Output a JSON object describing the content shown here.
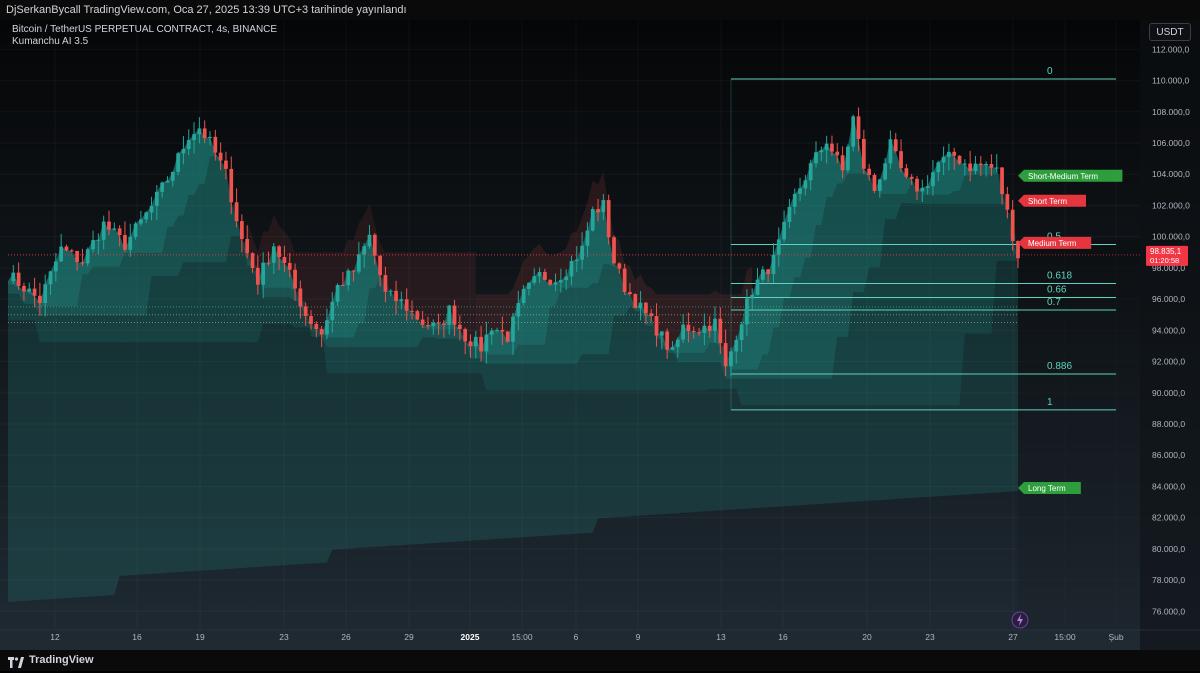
{
  "header": {
    "published_line": "DjSerkanBycall TradingView.com, Oca 27, 2025 13:39 UTC+3 tarihinde yayınlandı"
  },
  "legend": {
    "symbol_line": "Bitcoin / TetherUS PERPETUAL CONTRACT, 4s, BINANCE",
    "indicator_line": "Kumanchu AI 3.5"
  },
  "toolbar": {
    "currency_label": "USDT"
  },
  "footer": {
    "brand": "TradingView"
  },
  "colors": {
    "up": "#26a69a",
    "down": "#ef5350",
    "cloud": "#26a69a",
    "fib_line": "#5fd3bd",
    "label_green": "#2e9e3c",
    "label_red": "#e5363f",
    "price_tag": "#f23645"
  },
  "chart_data": {
    "type": "candlestick",
    "title": "Bitcoin / TetherUS PERPETUAL CONTRACT, 4s, BINANCE",
    "ylim": [
      74800,
      112600
    ],
    "y_ticks": [
      76000,
      78000,
      80000,
      82000,
      84000,
      86000,
      88000,
      90000,
      92000,
      94000,
      96000,
      98000,
      100000,
      102000,
      104000,
      106000,
      108000,
      110000,
      112000
    ],
    "y_tick_labels": [
      "76.000,0",
      "78.000,0",
      "80.000,0",
      "82.000,0",
      "84.000,0",
      "86.000,0",
      "88.000,0",
      "90.000,0",
      "92.000,0",
      "94.000,0",
      "96.000,0",
      "98.000,0",
      "100.000,0",
      "102.000,0",
      "104.000,0",
      "106.000,0",
      "108.000,0",
      "110.000,0",
      "112.000,0"
    ],
    "x_tick_labels": [
      "12",
      "16",
      "19",
      "23",
      "26",
      "29",
      "2025",
      "15:00",
      "6",
      "9",
      "13",
      "16",
      "20",
      "23",
      "27",
      "15:00",
      "Şub"
    ],
    "price_path": [
      [
        0,
        97600
      ],
      [
        6,
        95900
      ],
      [
        10,
        99200
      ],
      [
        14,
        98400
      ],
      [
        18,
        100800
      ],
      [
        22,
        99500
      ],
      [
        27,
        101900
      ],
      [
        31,
        104300
      ],
      [
        34,
        106500
      ],
      [
        36,
        107000
      ],
      [
        38,
        106000
      ],
      [
        41,
        104000
      ],
      [
        44,
        99800
      ],
      [
        47,
        97200
      ],
      [
        50,
        99500
      ],
      [
        53,
        97500
      ],
      [
        56,
        95000
      ],
      [
        59,
        93800
      ],
      [
        62,
        96800
      ],
      [
        65,
        97800
      ],
      [
        68,
        100000
      ],
      [
        71,
        96300
      ],
      [
        74,
        95800
      ],
      [
        78,
        94500
      ],
      [
        81,
        94100
      ],
      [
        83,
        95300
      ],
      [
        86,
        93600
      ],
      [
        89,
        92900
      ],
      [
        91,
        94300
      ],
      [
        94,
        93600
      ],
      [
        97,
        96300
      ],
      [
        100,
        97500
      ],
      [
        103,
        97300
      ],
      [
        105,
        97900
      ],
      [
        108,
        99200
      ],
      [
        110,
        101600
      ],
      [
        112,
        102000
      ],
      [
        114,
        98400
      ],
      [
        116,
        96800
      ],
      [
        119,
        95400
      ],
      [
        122,
        94100
      ],
      [
        125,
        92500
      ],
      [
        127,
        94200
      ],
      [
        130,
        94100
      ],
      [
        133,
        94500
      ],
      [
        135,
        91500
      ],
      [
        137,
        93800
      ],
      [
        140,
        96600
      ],
      [
        144,
        98500
      ],
      [
        148,
        102500
      ],
      [
        151,
        104500
      ],
      [
        154,
        106200
      ],
      [
        157,
        104200
      ],
      [
        159,
        107600
      ],
      [
        161,
        104500
      ],
      [
        163,
        103000
      ],
      [
        166,
        105800
      ],
      [
        169,
        103500
      ],
      [
        172,
        103000
      ],
      [
        175,
        104700
      ],
      [
        178,
        105200
      ],
      [
        181,
        104500
      ],
      [
        184,
        104600
      ],
      [
        186,
        104200
      ],
      [
        188,
        101500
      ],
      [
        190,
        98800
      ]
    ],
    "series": [
      {
        "name": "Short Term",
        "label": "Short Term"
      },
      {
        "name": "Short-Medium Term",
        "label": "Short-Medium Term"
      },
      {
        "name": "Medium Term",
        "label": "Medium Term"
      },
      {
        "name": "Long Term",
        "label": "Long Term"
      }
    ],
    "band_labels": [
      {
        "text": "Short-Medium Term",
        "price": 103900,
        "color": "green"
      },
      {
        "text": "Short Term",
        "price": 102300,
        "color": "red"
      },
      {
        "text": "Medium Term",
        "price": 99600,
        "color": "red"
      },
      {
        "text": "Long Term",
        "price": 83900,
        "color": "green"
      }
    ],
    "fib_levels": [
      {
        "label": "0",
        "price": 110100
      },
      {
        "label": "0.5",
        "price": 99500
      },
      {
        "label": "0.618",
        "price": 97000
      },
      {
        "label": "0.66",
        "price": 96100
      },
      {
        "label": "0.7",
        "price": 95300
      },
      {
        "label": "0.886",
        "price": 91200
      },
      {
        "label": "1",
        "price": 88900
      }
    ],
    "last_price": {
      "value": 98835.1,
      "label": "98.835,1",
      "timer": "01:20:58"
    }
  }
}
